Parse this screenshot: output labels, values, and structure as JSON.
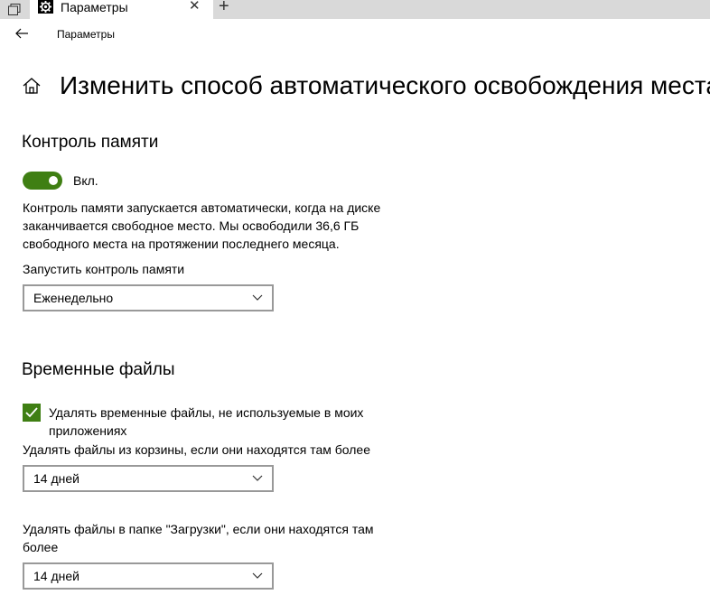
{
  "tab": {
    "title": "Параметры",
    "close_glyph": "✕",
    "new_glyph": "+"
  },
  "header": {
    "app_title": "Параметры"
  },
  "page": {
    "title": "Изменить способ автоматического освобождения места"
  },
  "storage_sense": {
    "heading": "Контроль памяти",
    "toggle_label": "Вкл.",
    "toggle_on": true,
    "description": "Контроль памяти запускается автоматически, когда на диске заканчивается свободное место. Мы освободили 36,6 ГБ свободного места на протяжении последнего месяца.",
    "run_label": "Запустить контроль памяти",
    "run_value": "Еженедельно"
  },
  "temp_files": {
    "heading": "Временные файлы",
    "delete_temp_label": "Удалять временные файлы, не используемые в моих приложениях",
    "delete_temp_checked": true,
    "recycle_label": "Удалять файлы из корзины, если они находятся там более",
    "recycle_value": "14 дней",
    "downloads_label": "Удалять файлы в папке \"Загрузки\", если они находятся там более",
    "downloads_value": "14 дней"
  },
  "colors": {
    "accent": "#3f7f13",
    "tabbar": "#d9d9d9",
    "border": "#999999"
  },
  "icons": [
    "restore-tabs-icon",
    "settings-gear-icon",
    "close-icon",
    "plus-icon",
    "back-arrow-icon",
    "home-icon",
    "chevron-down-icon",
    "checkmark-icon"
  ]
}
